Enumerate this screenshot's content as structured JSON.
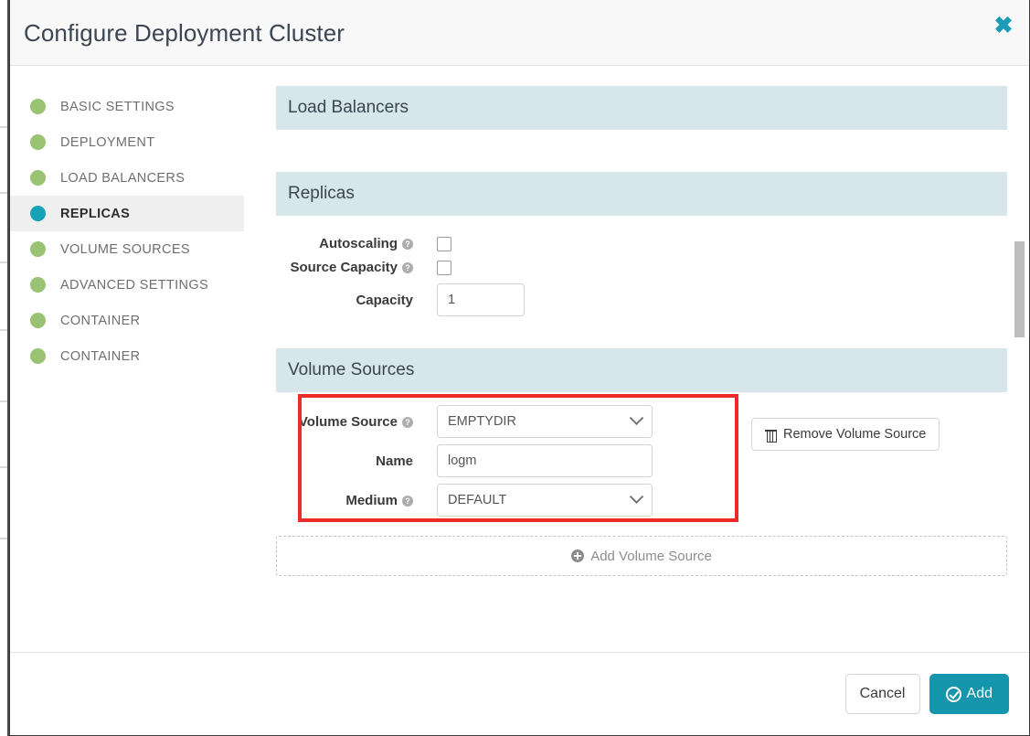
{
  "header": {
    "title": "Configure Deployment Cluster",
    "close_label": "✖"
  },
  "sidebar": {
    "items": [
      {
        "label": "BASIC SETTINGS",
        "active": false
      },
      {
        "label": "DEPLOYMENT",
        "active": false
      },
      {
        "label": "LOAD BALANCERS",
        "active": false
      },
      {
        "label": "REPLICAS",
        "active": true
      },
      {
        "label": "VOLUME SOURCES",
        "active": false
      },
      {
        "label": "ADVANCED SETTINGS",
        "active": false
      },
      {
        "label": "CONTAINER",
        "active": false
      },
      {
        "label": "CONTAINER",
        "active": false
      }
    ]
  },
  "sections": {
    "load_balancers": {
      "title": "Load Balancers"
    },
    "replicas": {
      "title": "Replicas",
      "autoscaling_label": "Autoscaling",
      "source_capacity_label": "Source Capacity",
      "capacity_label": "Capacity",
      "capacity_value": "1",
      "autoscaling_checked": false,
      "source_capacity_checked": false
    },
    "volume_sources": {
      "title": "Volume Sources",
      "volume_source_label": "Volume Source",
      "volume_source_value": "EMPTYDIR",
      "name_label": "Name",
      "name_value": "logm",
      "medium_label": "Medium",
      "medium_value": "DEFAULT",
      "remove_button": "Remove Volume Source",
      "add_button": "Add Volume Source"
    }
  },
  "footer": {
    "cancel_label": "Cancel",
    "add_label": "Add"
  },
  "icons": {
    "help": "?"
  },
  "colors": {
    "accent_teal": "#1596ad",
    "section_header_bg": "#d6e6ea",
    "nav_dot_green": "#83b653",
    "nav_dot_active": "#17a2b8",
    "annotation_red": "#ee2b2b"
  }
}
